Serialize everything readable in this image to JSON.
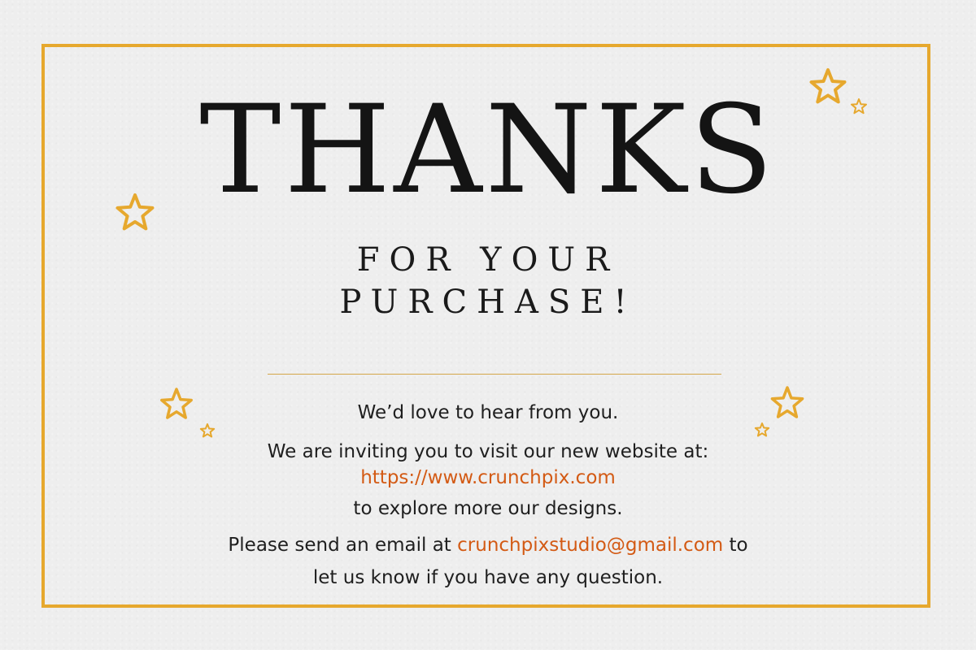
{
  "card": {
    "title": "THANKS",
    "subtitle_line1": "FOR YOUR",
    "subtitle_line2": "PURCHASE!",
    "line1": "We’d love to hear from you.",
    "line2": "We are inviting you to visit our new website at:",
    "website": "https://www.crunchpix.com",
    "line3": "to explore more our designs.",
    "email_prefix": "Please send an email at ",
    "email": "crunchpixstudio@gmail.com",
    "email_suffix": " to",
    "line4": "let us know if you have any question."
  },
  "colors": {
    "frame": "#e6a82e",
    "stars": "#e6a82e",
    "link": "#d35a14",
    "background": "#eeeeee",
    "text": "#1f1f1f"
  },
  "icons": [
    "star-icon"
  ]
}
